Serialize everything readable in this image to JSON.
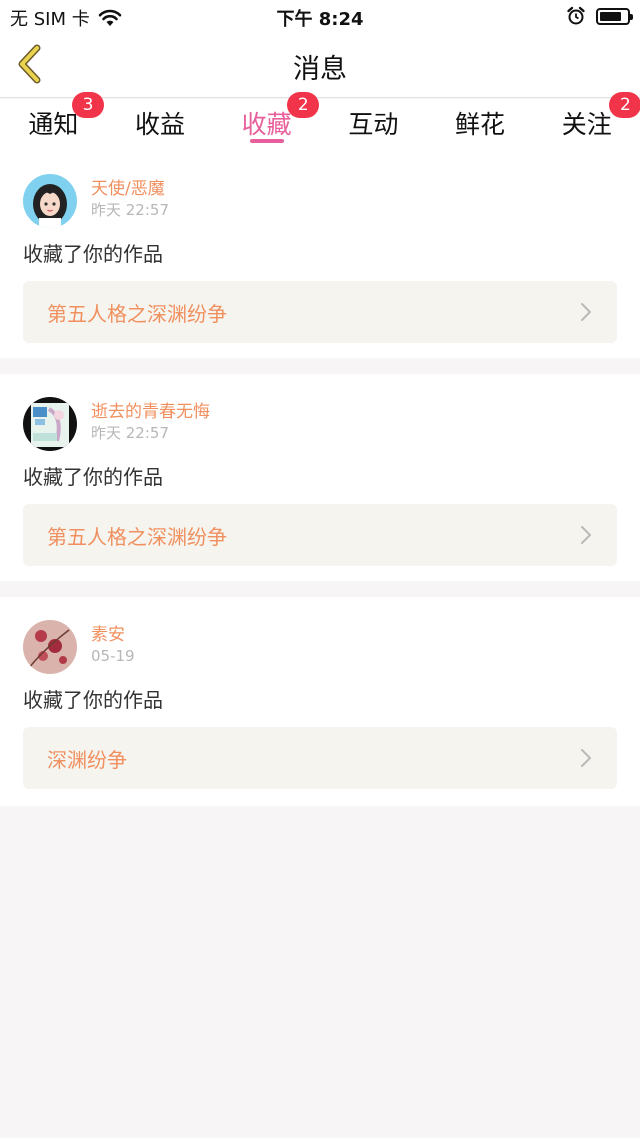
{
  "status_bar": {
    "carrier": "无 SIM 卡",
    "time": "下午 8:24",
    "battery_level": 0.8
  },
  "nav": {
    "title": "消息",
    "back_icon": "chevron-left-icon",
    "back_color": "#e9d44f"
  },
  "tabs": [
    {
      "label": "通知",
      "badge": "3"
    },
    {
      "label": "收益",
      "badge": ""
    },
    {
      "label": "收藏",
      "badge": "2",
      "active": true
    },
    {
      "label": "互动",
      "badge": ""
    },
    {
      "label": "鲜花",
      "badge": ""
    },
    {
      "label": "关注",
      "badge": "2"
    }
  ],
  "colors": {
    "accent_pink": "#e8609b",
    "badge_red": "#f2344a",
    "username_orange": "#f1905f",
    "link_bg": "#f5f4ef"
  },
  "messages": [
    {
      "username": "天使/恶魔",
      "time": "昨天 22:57",
      "action": "收藏了你的作品",
      "work_title": "第五人格之深渊纷争"
    },
    {
      "username": "逝去的青春无悔",
      "time": "昨天 22:57",
      "action": "收藏了你的作品",
      "work_title": "第五人格之深渊纷争"
    },
    {
      "username": "素安",
      "time": "05-19",
      "action": "收藏了你的作品",
      "work_title": "深渊纷争"
    }
  ]
}
